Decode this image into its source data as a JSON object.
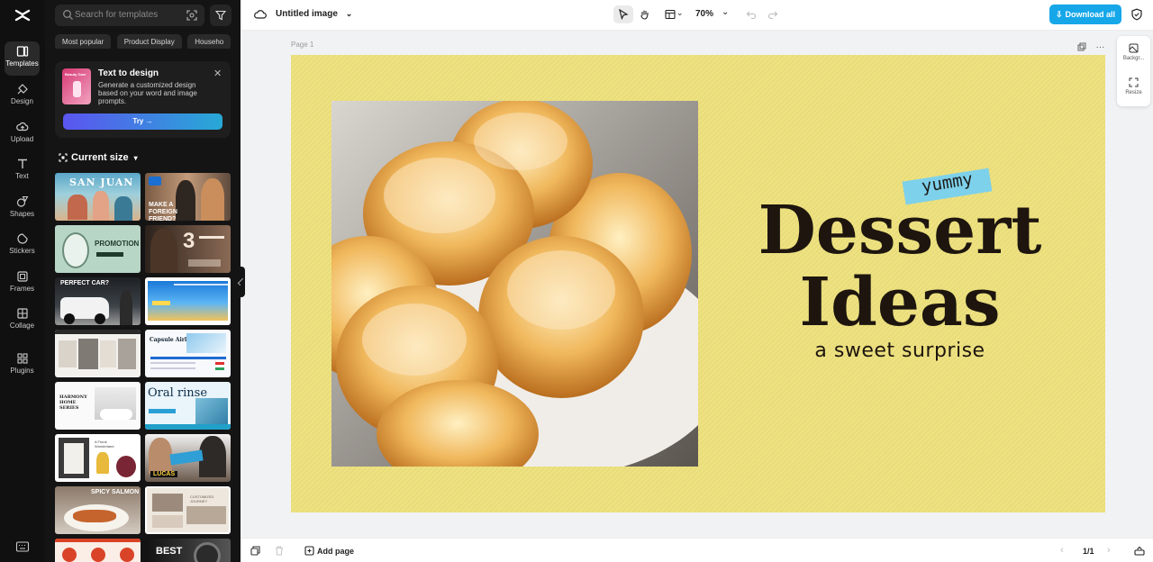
{
  "rail": {
    "items": [
      {
        "label": "Templates",
        "icon": "templates-icon"
      },
      {
        "label": "Design",
        "icon": "design-icon"
      },
      {
        "label": "Upload",
        "icon": "upload-icon"
      },
      {
        "label": "Text",
        "icon": "text-icon"
      },
      {
        "label": "Shapes",
        "icon": "shapes-icon"
      },
      {
        "label": "Stickers",
        "icon": "stickers-icon"
      },
      {
        "label": "Frames",
        "icon": "frames-icon"
      },
      {
        "label": "Collage",
        "icon": "collage-icon"
      },
      {
        "label": "Plugins",
        "icon": "plugins-icon"
      }
    ]
  },
  "panel": {
    "search_placeholder": "Search for templates",
    "chips": [
      "Most popular",
      "Product Display",
      "Househo"
    ],
    "text_to_design": {
      "title": "Text to design",
      "description": "Generate a customized design based on your word and image prompts.",
      "try_label": "Try →",
      "thumb_text": "Beauty Care"
    },
    "current_size_label": "Current size",
    "templates": [
      {
        "caption": "SAN JUAN"
      },
      {
        "caption": "MAKE A FOREIGN FRIEND?"
      },
      {
        "caption": "PROMOTION"
      },
      {
        "caption": "3"
      },
      {
        "caption": "PERFECT CAR?"
      },
      {
        "caption": ""
      },
      {
        "caption": ""
      },
      {
        "caption": "Capsule Airline"
      },
      {
        "caption": "HARMONY HOME SERIES"
      },
      {
        "caption": "Oral rinse"
      },
      {
        "caption": "A Floral Wonderland"
      },
      {
        "caption": "LUCAS"
      },
      {
        "caption": "SPICY SALMON"
      },
      {
        "caption": "CUSTOMIZED JOURNEY"
      },
      {
        "caption": ""
      },
      {
        "caption": "BEST"
      }
    ]
  },
  "topbar": {
    "title": "Untitled image",
    "zoom": "70%",
    "download_label": "Download all"
  },
  "canvas": {
    "page_label": "Page 1",
    "tag": "yummy",
    "headline_1": "Dessert",
    "headline_2": "Ideas",
    "subtitle": "a sweet surprise",
    "background_color": "#ede07c"
  },
  "side_tools": [
    {
      "label": "Backgr..."
    },
    {
      "label": "Resize"
    }
  ],
  "bottombar": {
    "add_page_label": "Add page",
    "pagination": "1/1"
  },
  "colors": {
    "accent": "#16a7e9",
    "rail_bg": "#101010",
    "panel_bg": "#141414"
  }
}
